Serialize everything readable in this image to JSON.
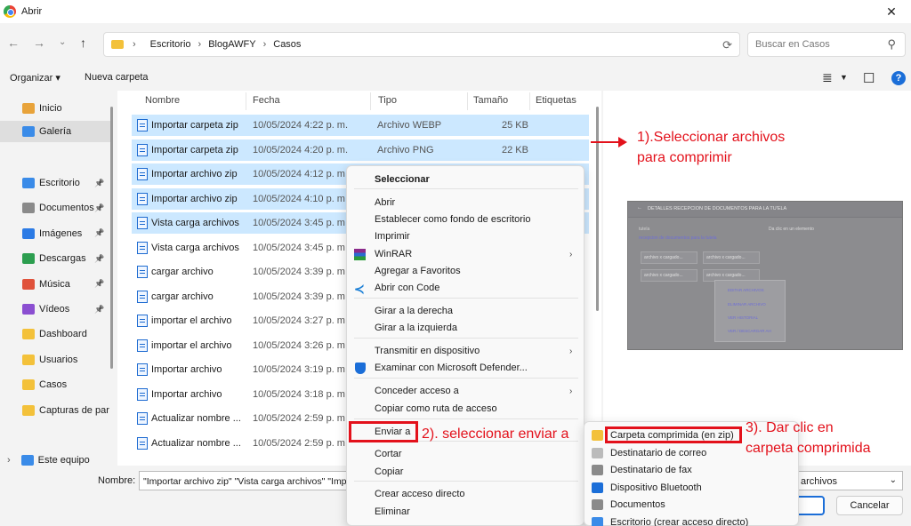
{
  "window": {
    "title": "Abrir",
    "close_glyph": "✕"
  },
  "address": {
    "path": [
      "Escritorio",
      "BlogAWFY",
      "Casos"
    ],
    "search_placeholder": "Buscar en Casos"
  },
  "commands": {
    "organize": "Organizar ▾",
    "new_folder": "Nueva carpeta",
    "help": "?"
  },
  "sidebar": {
    "items": [
      {
        "label": "Inicio",
        "top": 0,
        "color": "#e8a33a",
        "pin": false,
        "sel": false
      },
      {
        "label": "Galería",
        "top": 1,
        "color": "#3a8be8",
        "pin": false,
        "sel": true
      }
    ],
    "places": [
      {
        "label": "Escritorio",
        "color": "#3a8be8"
      },
      {
        "label": "Documentos",
        "color": "#8a8a8a"
      },
      {
        "label": "Imágenes",
        "color": "#2c7be5"
      },
      {
        "label": "Descargas",
        "color": "#2c9e4f"
      },
      {
        "label": "Música",
        "color": "#e0523b"
      },
      {
        "label": "Vídeos",
        "color": "#8b4fd1"
      },
      {
        "label": "Dashboard",
        "color": "#f3c13a"
      },
      {
        "label": "Usuarios",
        "color": "#f3c13a"
      },
      {
        "label": "Casos",
        "color": "#f3c13a"
      },
      {
        "label": "Capturas de par",
        "color": "#f3c13a"
      }
    ],
    "this_pc": "Este equipo"
  },
  "columns": {
    "name": "Nombre",
    "date": "Fecha",
    "type": "Tipo",
    "size": "Tamaño",
    "tags": "Etiquetas"
  },
  "files": [
    {
      "name": "Importar carpeta zip",
      "date": "10/05/2024 4:22 p. m.",
      "type": "Archivo WEBP",
      "size": "25 KB",
      "sel": true
    },
    {
      "name": "Importar carpeta zip",
      "date": "10/05/2024 4:20 p. m.",
      "type": "Archivo PNG",
      "size": "22 KB",
      "sel": true
    },
    {
      "name": "Importar archivo zip",
      "date": "10/05/2024 4:12 p. m.",
      "type": "",
      "size": "",
      "sel": true
    },
    {
      "name": "Importar archivo zip",
      "date": "10/05/2024 4:10 p. m.",
      "type": "",
      "size": "",
      "sel": true
    },
    {
      "name": "Vista carga archivos",
      "date": "10/05/2024 3:45 p. m.",
      "type": "",
      "size": "",
      "sel": true
    },
    {
      "name": "Vista carga archivos",
      "date": "10/05/2024 3:45 p. m.",
      "type": "",
      "size": "",
      "sel": false
    },
    {
      "name": "cargar archivo",
      "date": "10/05/2024 3:39 p. m.",
      "type": "",
      "size": "",
      "sel": false
    },
    {
      "name": "cargar archivo",
      "date": "10/05/2024 3:39 p. m.",
      "type": "",
      "size": "",
      "sel": false
    },
    {
      "name": "importar el archivo",
      "date": "10/05/2024 3:27 p. m.",
      "type": "",
      "size": "",
      "sel": false
    },
    {
      "name": "importar el archivo",
      "date": "10/05/2024 3:26 p. m.",
      "type": "",
      "size": "",
      "sel": false
    },
    {
      "name": "Importar archivo",
      "date": "10/05/2024 3:19 p. m.",
      "type": "",
      "size": "",
      "sel": false
    },
    {
      "name": "Importar archivo",
      "date": "10/05/2024 3:18 p. m.",
      "type": "",
      "size": "",
      "sel": false
    },
    {
      "name": "Actualizar nombre ...",
      "date": "10/05/2024 2:59 p. m.",
      "type": "",
      "size": "",
      "sel": false
    },
    {
      "name": "Actualizar nombre ...",
      "date": "10/05/2024 2:59 p. m.",
      "type": "",
      "size": "",
      "sel": false
    }
  ],
  "context_menu": {
    "items": [
      {
        "label": "Seleccionar",
        "bold": true,
        "arrow": false,
        "icon": ""
      },
      {
        "label": "Abrir",
        "bold": false,
        "arrow": false,
        "icon": ""
      },
      {
        "label": "Establecer como fondo de escritorio",
        "bold": false,
        "arrow": false,
        "icon": ""
      },
      {
        "label": "Imprimir",
        "bold": false,
        "arrow": false,
        "icon": ""
      },
      {
        "label": "WinRAR",
        "bold": false,
        "arrow": true,
        "icon": "winrar"
      },
      {
        "label": "Agregar a Favoritos",
        "bold": false,
        "arrow": false,
        "icon": ""
      },
      {
        "label": "Abrir con Code",
        "bold": false,
        "arrow": false,
        "icon": "vscode"
      },
      {
        "label": "Girar a la derecha",
        "bold": false,
        "arrow": false,
        "icon": ""
      },
      {
        "label": "Girar a la izquierda",
        "bold": false,
        "arrow": false,
        "icon": ""
      },
      {
        "label": "Transmitir en dispositivo",
        "bold": false,
        "arrow": true,
        "icon": ""
      },
      {
        "label": "Examinar con Microsoft Defender...",
        "bold": false,
        "arrow": false,
        "icon": "defender"
      },
      {
        "label": "Conceder acceso a",
        "bold": false,
        "arrow": true,
        "icon": ""
      },
      {
        "label": "Copiar como ruta de acceso",
        "bold": false,
        "arrow": false,
        "icon": ""
      },
      {
        "label": "Enviar a",
        "bold": false,
        "arrow": false,
        "icon": ""
      },
      {
        "label": "Cortar",
        "bold": false,
        "arrow": false,
        "icon": ""
      },
      {
        "label": "Copiar",
        "bold": false,
        "arrow": false,
        "icon": ""
      },
      {
        "label": "Crear acceso directo",
        "bold": false,
        "arrow": false,
        "icon": ""
      },
      {
        "label": "Eliminar",
        "bold": false,
        "arrow": false,
        "icon": ""
      }
    ]
  },
  "send_to_menu": {
    "items": [
      {
        "label": "Carpeta comprimida (en zip)",
        "icon": "zip-folder-icon",
        "color": "#f3c13a"
      },
      {
        "label": "Destinatario de correo",
        "icon": "mail-icon",
        "color": "#bbbbbb"
      },
      {
        "label": "Destinatario de fax",
        "icon": "fax-icon",
        "color": "#8a8a8a"
      },
      {
        "label": "Dispositivo Bluetooth",
        "icon": "bluetooth-icon",
        "color": "#1b6ed8"
      },
      {
        "label": "Documentos",
        "icon": "documents-icon",
        "color": "#8a8a8a"
      },
      {
        "label": "Escritorio (crear acceso directo)",
        "icon": "desktop-icon",
        "color": "#3a8be8"
      }
    ]
  },
  "bottom": {
    "filename_label": "Nombre:",
    "filename_value": "\"Importar archivo zip\" \"Vista carga archivos\" \"Imp",
    "filter": "archivos",
    "cancel": "Cancelar"
  },
  "annotations": {
    "step1": "1).Seleccionar archivos",
    "step1b": "para comprimir",
    "step2": "2). seleccionar enviar a",
    "step3": "3). Dar clic en",
    "step3b": "carpeta comprimida"
  },
  "preview": {
    "title": "DETALLES RECEPCION DE DOCUMENTOS PARA LA TU'ELA",
    "tab": "tutela",
    "link": "recepcion de documentos para la tutela",
    "field": "Da clic en un elemento",
    "file1": "archivo x cargado...",
    "file2": "archivo x cargado...",
    "file3": "archivo x cargado...",
    "file4": "archivo x cargado...",
    "menu": [
      "EDITAR ARCHIVOS",
      "ELIMINAR ARCHIVO",
      "VER HISTORIAL",
      "VER / DESCARGAR AH"
    ]
  },
  "colors": {
    "accent": "#1b6ed8",
    "selection": "#cce8ff",
    "annotation": "#e3111b"
  }
}
